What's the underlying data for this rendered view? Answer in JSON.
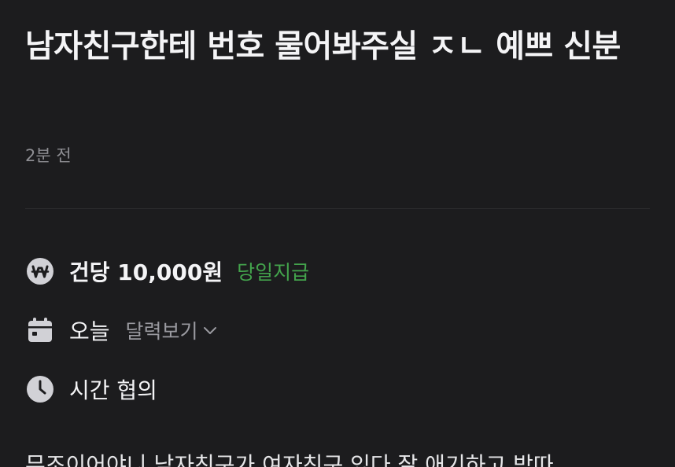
{
  "post": {
    "title": "남자친구한테 번호 물어봐주실 ㅈㄴ 예쁘 신분",
    "time_ago": "2분 전"
  },
  "details": {
    "pay": {
      "icon": "won-coin-icon",
      "amount": "건당 10,000원",
      "badge": "당일지급",
      "badge_color": "#43a34c"
    },
    "date": {
      "icon": "calendar-icon",
      "value": "오늘",
      "link_label": "달력보기",
      "link_icon": "chevron-down-icon"
    },
    "time": {
      "icon": "clock-icon",
      "value": "시간 협의"
    }
  },
  "body": {
    "preview": "무조이어야니 남자친구가 여자친구 있다 잘 애기하고 받따"
  },
  "colors": {
    "background": "#1c1c1e",
    "accent_green": "#43a34c",
    "muted_text": "#8e8e93"
  }
}
